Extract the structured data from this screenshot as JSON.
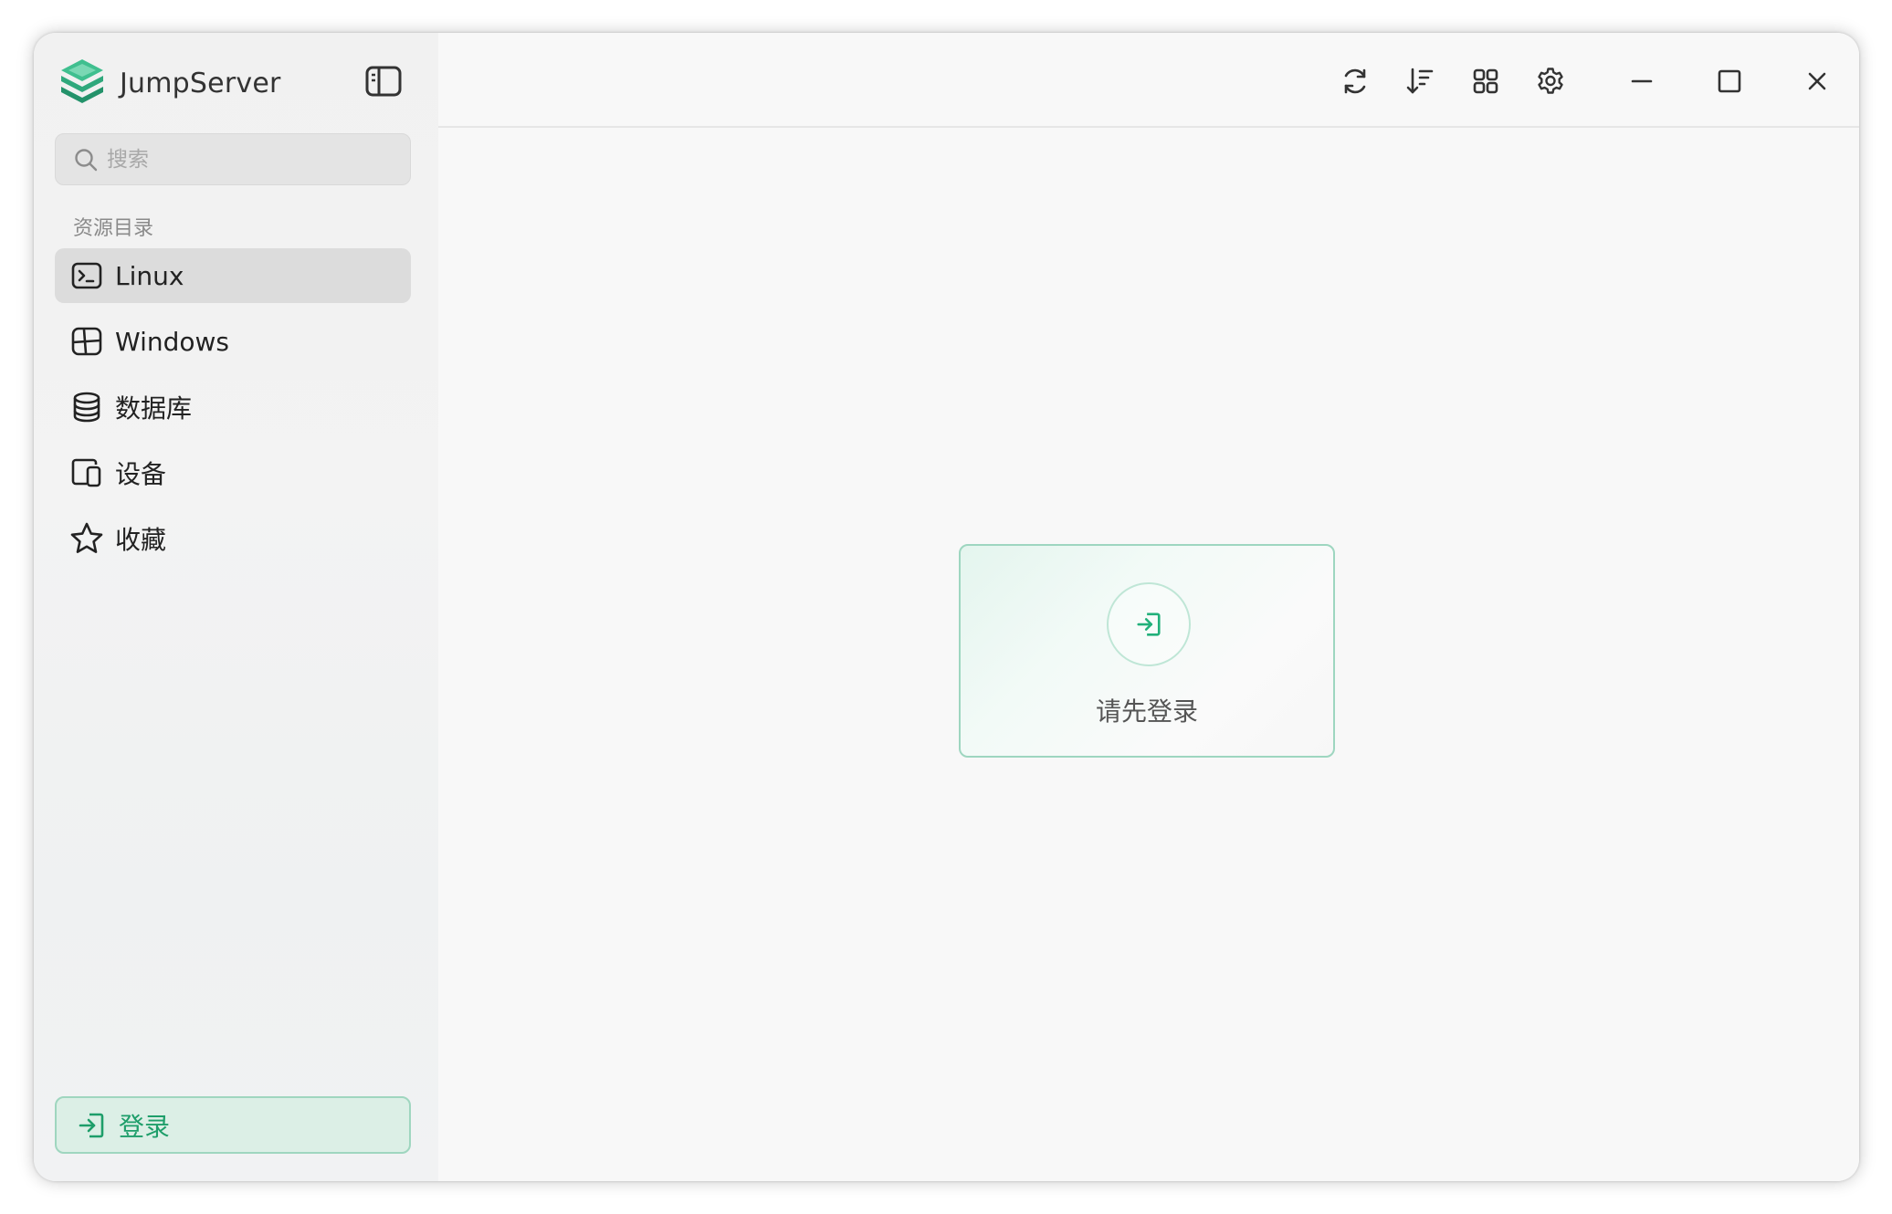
{
  "app": {
    "name": "JumpServer"
  },
  "search": {
    "placeholder": "搜索"
  },
  "sidebar": {
    "section_title": "资源目录",
    "items": [
      {
        "label": "Linux",
        "icon": "terminal-icon",
        "active": true
      },
      {
        "label": "Windows",
        "icon": "windows-icon",
        "active": false
      },
      {
        "label": "数据库",
        "icon": "database-icon",
        "active": false
      },
      {
        "label": "设备",
        "icon": "device-icon",
        "active": false
      },
      {
        "label": "收藏",
        "icon": "star-icon",
        "active": false
      }
    ],
    "login_label": "登录"
  },
  "toolbar": {
    "icons": [
      "refresh-icon",
      "sort-icon",
      "grid-icon",
      "gear-icon",
      "minimize-icon",
      "maximize-icon",
      "close-icon"
    ]
  },
  "main": {
    "login_prompt": "请先登录"
  },
  "colors": {
    "accent": "#1e9e6a",
    "accent_border": "#9fd6bf",
    "active_item_bg": "#dcdcdc"
  }
}
